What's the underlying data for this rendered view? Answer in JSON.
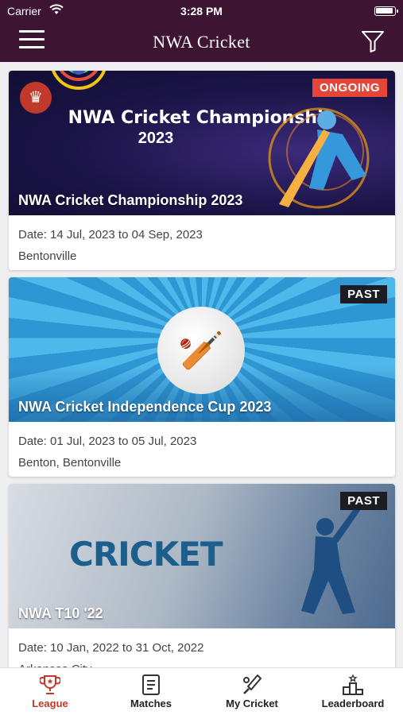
{
  "status": {
    "carrier": "Carrier",
    "time": "3:28 PM"
  },
  "nav": {
    "title": "NWA Cricket"
  },
  "leagues": [
    {
      "badge": "ONGOING",
      "banner_heading": "NWA Cricket Championship",
      "banner_year": "2023",
      "title": "NWA Cricket Championship 2023",
      "date": "Date: 14 Jul, 2023 to 04 Sep, 2023",
      "location": "Bentonville"
    },
    {
      "badge": "PAST",
      "title": "NWA Cricket Independence Cup 2023",
      "date": "Date: 01 Jul, 2023 to 05 Jul, 2023",
      "location": "Benton, Bentonville"
    },
    {
      "badge": "PAST",
      "banner_word": "CRICKET",
      "title": "NWA T10 '22",
      "date": "Date: 10 Jan, 2022 to 31 Oct, 2022",
      "location": "Arkansas City"
    }
  ],
  "tabs": [
    {
      "label": "League",
      "icon": "trophy-icon"
    },
    {
      "label": "Matches",
      "icon": "scorecard-icon"
    },
    {
      "label": "My Cricket",
      "icon": "cricket-bat-icon"
    },
    {
      "label": "Leaderboard",
      "icon": "podium-icon"
    }
  ],
  "colors": {
    "header": "#3d1533",
    "accent": "#c0392b",
    "ongoing_badge": "#e6453a",
    "past_badge": "#1c1c24"
  }
}
